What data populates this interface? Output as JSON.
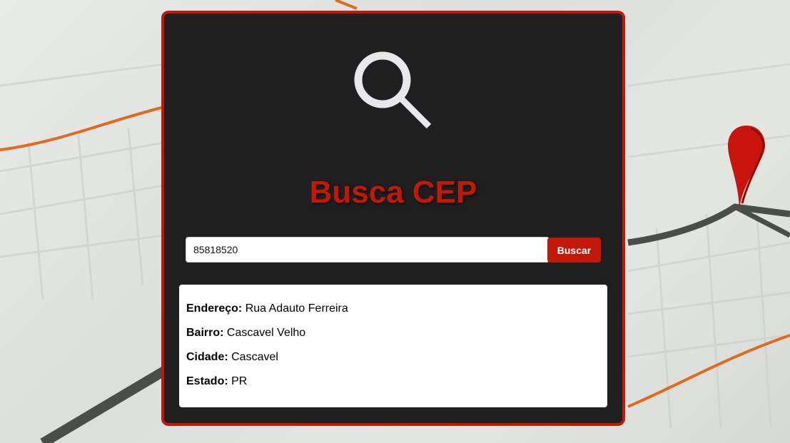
{
  "app": {
    "title": "Busca CEP"
  },
  "search": {
    "value": "85818520",
    "button_label": "Buscar"
  },
  "result": {
    "fields": [
      {
        "label": "Endereço:",
        "value": "Rua Adauto Ferreira"
      },
      {
        "label": "Bairro:",
        "value": "Cascavel Velho"
      },
      {
        "label": "Cidade:",
        "value": "Cascavel"
      },
      {
        "label": "Estado:",
        "value": "PR"
      }
    ]
  },
  "colors": {
    "accent": "#c21807",
    "panel": "#1f1f1f",
    "icon": "#e8e8ec"
  },
  "icons": {
    "header": "search-icon",
    "background_marker": "map-pin-icon"
  }
}
